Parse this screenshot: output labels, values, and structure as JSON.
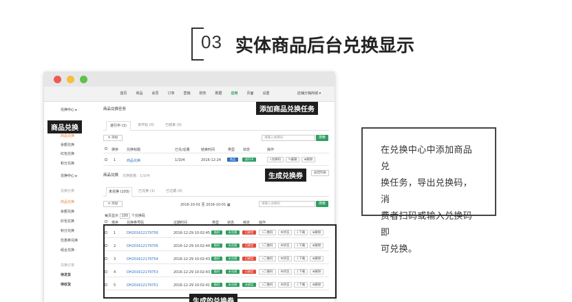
{
  "heading": {
    "number": "03",
    "title": "实体商品后台兑换显示"
  },
  "topnav": {
    "items": [
      "首页",
      "商品",
      "会员",
      "订单",
      "营销",
      "财务",
      "数据",
      "应用",
      "页面",
      "设置"
    ],
    "active_index": 7,
    "user": "店铺分销商城 ▾"
  },
  "sidebar": {
    "items": [
      {
        "label": "兑换中心 ▸",
        "style": "hd"
      },
      {
        "label": "商品兑换",
        "style": "act"
      },
      {
        "label": "余额兑换",
        "style": ""
      },
      {
        "label": "红包兑换",
        "style": ""
      },
      {
        "label": "积分兑换",
        "style": ""
      },
      {
        "label": "兑换中心 ▸",
        "style": "hd"
      },
      {
        "label": "兑换分类",
        "style": "gray"
      },
      {
        "label": "商品兑换",
        "style": "act"
      },
      {
        "label": "余额兑换",
        "style": ""
      },
      {
        "label": "红包兑换",
        "style": ""
      },
      {
        "label": "积分兑换",
        "style": ""
      },
      {
        "label": "优惠券兑换",
        "style": ""
      },
      {
        "label": "组合兑换",
        "style": ""
      },
      {
        "label": "兑换订单",
        "style": "gray"
      },
      {
        "label": "待发货",
        "style": "b"
      },
      {
        "label": "待收货",
        "style": "b"
      }
    ]
  },
  "callouts": {
    "goods_exchange": "商品兑换",
    "add_task": "添加商品兑换任务",
    "generate_code": "生成兑换券",
    "generated_codes": "生成的兑换券"
  },
  "task_section": {
    "title": "商品兑换任务",
    "tabs": [
      "进行中 (1)",
      "未开始 (0)",
      "已结束 (0)"
    ],
    "add_button": "添加",
    "search_placeholder": "请输入关键词",
    "search_button": "搜索",
    "columns": [
      "排序",
      "兑换标题",
      "已兑/总量",
      "结束时间",
      "类型",
      "状态",
      "操作"
    ],
    "row": {
      "sort": "1",
      "title": "商品兑换",
      "ratio": "1/104",
      "end": "2016-12-24",
      "type": "商品",
      "status": "进行中",
      "actions": [
        "兑换码",
        "编辑",
        "删除"
      ]
    }
  },
  "code_section": {
    "title": "商品兑换",
    "subtitle": "兑换数量：1/104",
    "back_button": "返回列表",
    "tabs": [
      "未兑换 (103)",
      "已兑换 (1)",
      "已过期 (0)"
    ],
    "add_button": "添加",
    "date_range": "2016-10-01 至 2016-10-01",
    "search_placeholder": "请输入兑换码",
    "search_button": "搜索",
    "per_page_prefix": "每页显示",
    "per_page_value": "100",
    "per_page_suffix": "个兑换码",
    "columns": [
      "排序",
      "兑换券号码",
      "过期时间",
      "类型",
      "状态",
      "绑定",
      "操作"
    ],
    "rows": [
      {
        "idx": "1",
        "code": "DH201612179756",
        "expire": "2016-12-29 10:02:45",
        "type": "临时",
        "status": "未兑换",
        "bind": "已绑定",
        "bind_color": "red"
      },
      {
        "idx": "2",
        "code": "DH201612179756",
        "expire": "2016-12-29 10:02:44",
        "type": "临时",
        "status": "未兑换",
        "bind": "已绑定",
        "bind_color": "red"
      },
      {
        "idx": "3",
        "code": "DH201612179754",
        "expire": "2016-12-29 10:02:43",
        "type": "临时",
        "status": "未兑换",
        "bind": "已绑定",
        "bind_color": "red"
      },
      {
        "idx": "4",
        "code": "DH201612179753",
        "expire": "2016-12-29 10:02:43",
        "type": "临时",
        "status": "未兑换",
        "bind": "已绑定",
        "bind_color": "red"
      },
      {
        "idx": "5",
        "code": "DH201612179751",
        "expire": "2016-12-29 10:02:41",
        "type": "临时",
        "status": "未兑换",
        "bind": "未绑定",
        "bind_color": "green"
      }
    ],
    "row_actions": [
      "二维码",
      "状态",
      "下载",
      "删除"
    ]
  },
  "info": {
    "lines": [
      "在兑换中心中添加商品兑",
      "换任务，导出兑换码，消",
      "费者扫码或输入兑换码即",
      "可兑换。"
    ]
  },
  "colors": {
    "accent_green": "#2e9f62",
    "accent_orange": "#ee7b2d",
    "tag_red": "#e34a3a",
    "tag_blue": "#2a6fbe"
  }
}
